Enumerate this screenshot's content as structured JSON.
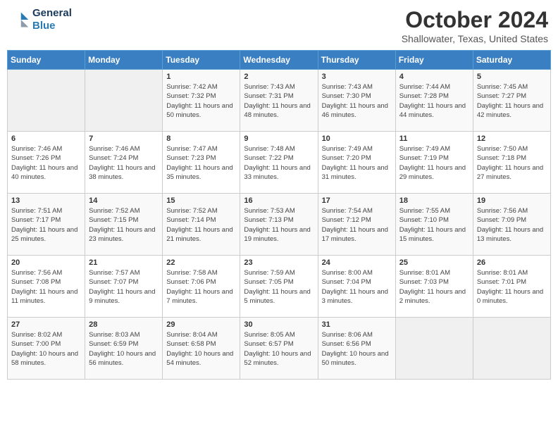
{
  "header": {
    "logo_line1": "General",
    "logo_line2": "Blue",
    "month": "October 2024",
    "location": "Shallowater, Texas, United States"
  },
  "days_of_week": [
    "Sunday",
    "Monday",
    "Tuesday",
    "Wednesday",
    "Thursday",
    "Friday",
    "Saturday"
  ],
  "weeks": [
    [
      {
        "day": "",
        "info": ""
      },
      {
        "day": "",
        "info": ""
      },
      {
        "day": "1",
        "info": "Sunrise: 7:42 AM\nSunset: 7:32 PM\nDaylight: 11 hours and 50 minutes."
      },
      {
        "day": "2",
        "info": "Sunrise: 7:43 AM\nSunset: 7:31 PM\nDaylight: 11 hours and 48 minutes."
      },
      {
        "day": "3",
        "info": "Sunrise: 7:43 AM\nSunset: 7:30 PM\nDaylight: 11 hours and 46 minutes."
      },
      {
        "day": "4",
        "info": "Sunrise: 7:44 AM\nSunset: 7:28 PM\nDaylight: 11 hours and 44 minutes."
      },
      {
        "day": "5",
        "info": "Sunrise: 7:45 AM\nSunset: 7:27 PM\nDaylight: 11 hours and 42 minutes."
      }
    ],
    [
      {
        "day": "6",
        "info": "Sunrise: 7:46 AM\nSunset: 7:26 PM\nDaylight: 11 hours and 40 minutes."
      },
      {
        "day": "7",
        "info": "Sunrise: 7:46 AM\nSunset: 7:24 PM\nDaylight: 11 hours and 38 minutes."
      },
      {
        "day": "8",
        "info": "Sunrise: 7:47 AM\nSunset: 7:23 PM\nDaylight: 11 hours and 35 minutes."
      },
      {
        "day": "9",
        "info": "Sunrise: 7:48 AM\nSunset: 7:22 PM\nDaylight: 11 hours and 33 minutes."
      },
      {
        "day": "10",
        "info": "Sunrise: 7:49 AM\nSunset: 7:20 PM\nDaylight: 11 hours and 31 minutes."
      },
      {
        "day": "11",
        "info": "Sunrise: 7:49 AM\nSunset: 7:19 PM\nDaylight: 11 hours and 29 minutes."
      },
      {
        "day": "12",
        "info": "Sunrise: 7:50 AM\nSunset: 7:18 PM\nDaylight: 11 hours and 27 minutes."
      }
    ],
    [
      {
        "day": "13",
        "info": "Sunrise: 7:51 AM\nSunset: 7:17 PM\nDaylight: 11 hours and 25 minutes."
      },
      {
        "day": "14",
        "info": "Sunrise: 7:52 AM\nSunset: 7:15 PM\nDaylight: 11 hours and 23 minutes."
      },
      {
        "day": "15",
        "info": "Sunrise: 7:52 AM\nSunset: 7:14 PM\nDaylight: 11 hours and 21 minutes."
      },
      {
        "day": "16",
        "info": "Sunrise: 7:53 AM\nSunset: 7:13 PM\nDaylight: 11 hours and 19 minutes."
      },
      {
        "day": "17",
        "info": "Sunrise: 7:54 AM\nSunset: 7:12 PM\nDaylight: 11 hours and 17 minutes."
      },
      {
        "day": "18",
        "info": "Sunrise: 7:55 AM\nSunset: 7:10 PM\nDaylight: 11 hours and 15 minutes."
      },
      {
        "day": "19",
        "info": "Sunrise: 7:56 AM\nSunset: 7:09 PM\nDaylight: 11 hours and 13 minutes."
      }
    ],
    [
      {
        "day": "20",
        "info": "Sunrise: 7:56 AM\nSunset: 7:08 PM\nDaylight: 11 hours and 11 minutes."
      },
      {
        "day": "21",
        "info": "Sunrise: 7:57 AM\nSunset: 7:07 PM\nDaylight: 11 hours and 9 minutes."
      },
      {
        "day": "22",
        "info": "Sunrise: 7:58 AM\nSunset: 7:06 PM\nDaylight: 11 hours and 7 minutes."
      },
      {
        "day": "23",
        "info": "Sunrise: 7:59 AM\nSunset: 7:05 PM\nDaylight: 11 hours and 5 minutes."
      },
      {
        "day": "24",
        "info": "Sunrise: 8:00 AM\nSunset: 7:04 PM\nDaylight: 11 hours and 3 minutes."
      },
      {
        "day": "25",
        "info": "Sunrise: 8:01 AM\nSunset: 7:03 PM\nDaylight: 11 hours and 2 minutes."
      },
      {
        "day": "26",
        "info": "Sunrise: 8:01 AM\nSunset: 7:01 PM\nDaylight: 11 hours and 0 minutes."
      }
    ],
    [
      {
        "day": "27",
        "info": "Sunrise: 8:02 AM\nSunset: 7:00 PM\nDaylight: 10 hours and 58 minutes."
      },
      {
        "day": "28",
        "info": "Sunrise: 8:03 AM\nSunset: 6:59 PM\nDaylight: 10 hours and 56 minutes."
      },
      {
        "day": "29",
        "info": "Sunrise: 8:04 AM\nSunset: 6:58 PM\nDaylight: 10 hours and 54 minutes."
      },
      {
        "day": "30",
        "info": "Sunrise: 8:05 AM\nSunset: 6:57 PM\nDaylight: 10 hours and 52 minutes."
      },
      {
        "day": "31",
        "info": "Sunrise: 8:06 AM\nSunset: 6:56 PM\nDaylight: 10 hours and 50 minutes."
      },
      {
        "day": "",
        "info": ""
      },
      {
        "day": "",
        "info": ""
      }
    ]
  ]
}
